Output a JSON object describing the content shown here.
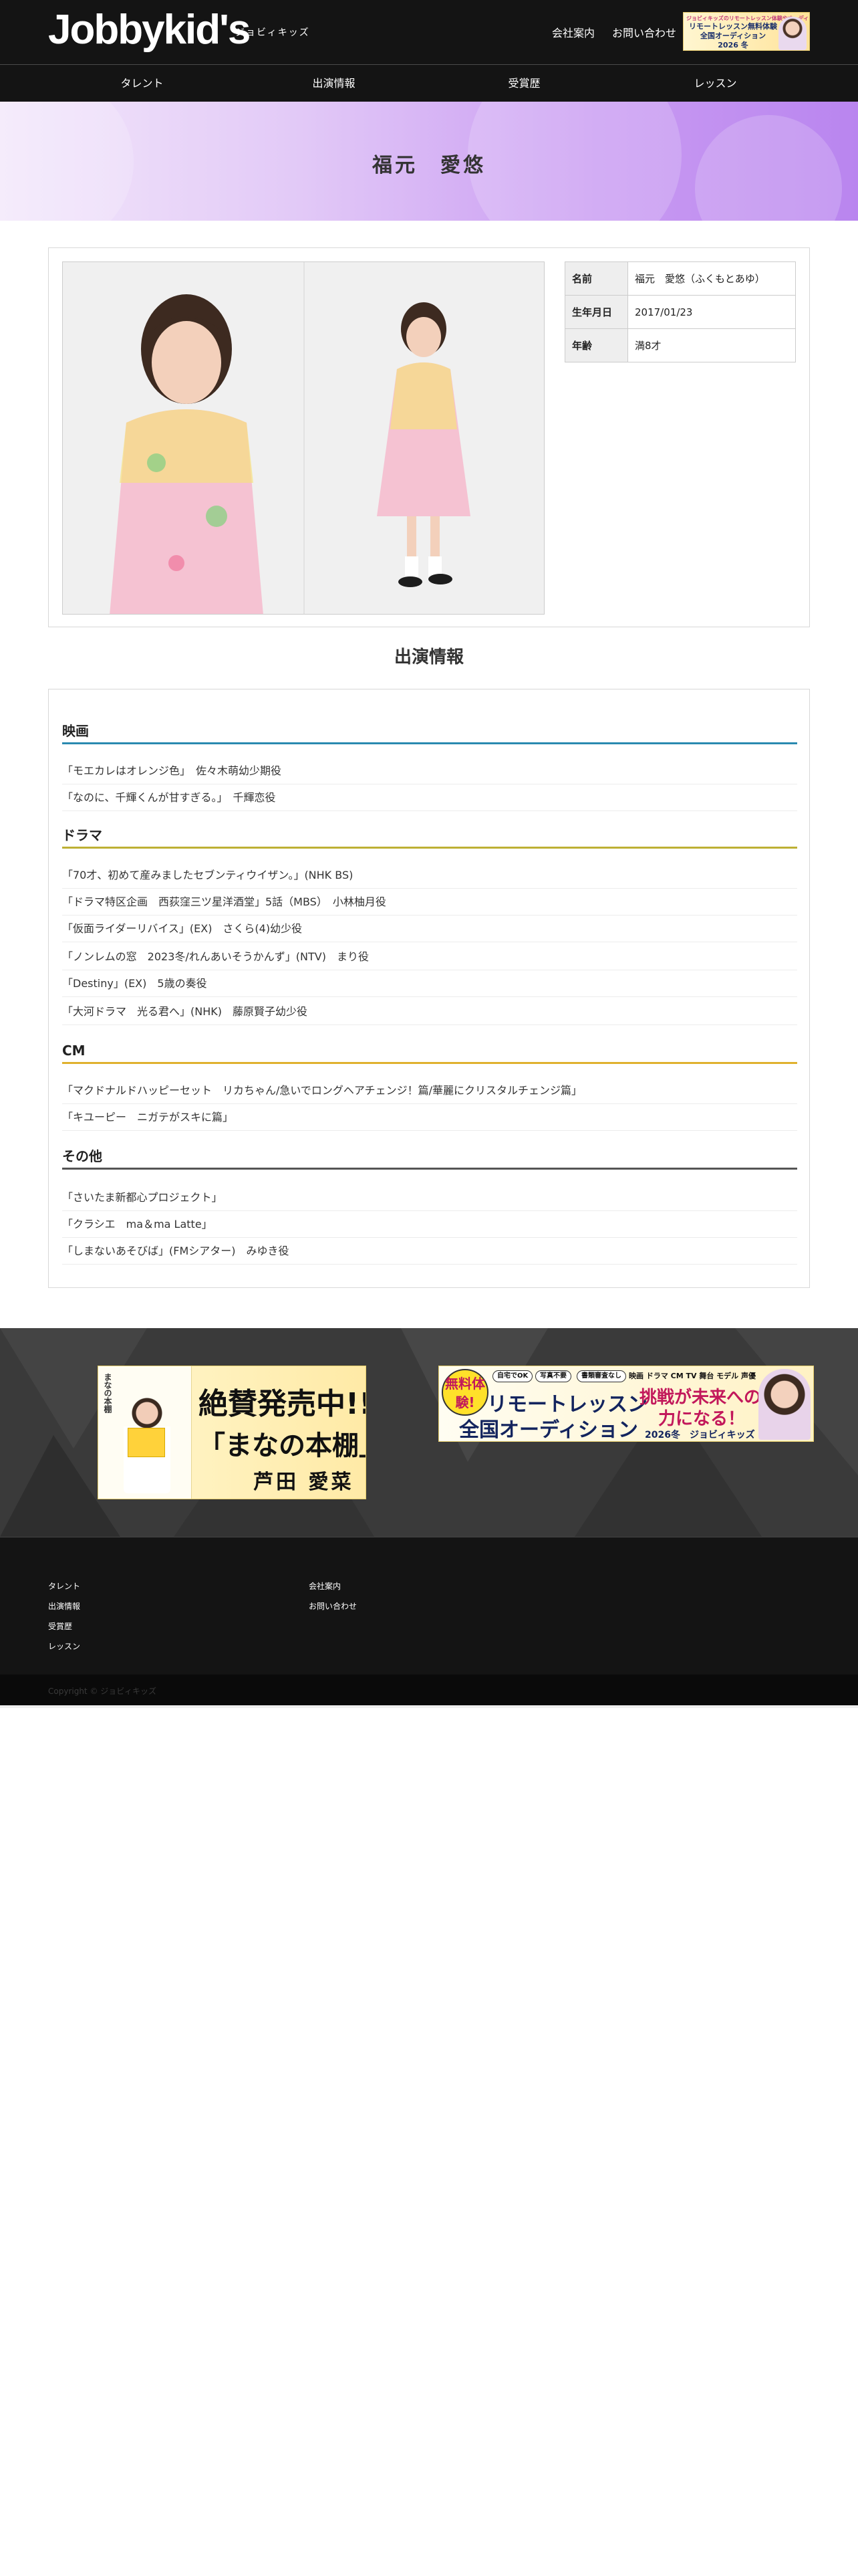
{
  "header": {
    "logo": "Jobbykid's",
    "logo_sub": "ジョビィキッズ",
    "links": [
      "会社案内",
      "お問い合わせ"
    ],
    "banner": {
      "top_text": "ジョビィキッズのリモートレッスン体験やオーディション",
      "main_text": "リモートレッスン無料体験 全国オーディション",
      "year_text": "2026 冬"
    }
  },
  "nav": {
    "items": [
      "タレント",
      "出演情報",
      "受賞歴",
      "レッスン"
    ]
  },
  "hero": {
    "title": "福元　愛悠"
  },
  "profile": {
    "rows": [
      {
        "label": "名前",
        "value": "福元　愛悠（ふくもとあゆ）"
      },
      {
        "label": "生年月日",
        "value": "2017/01/23"
      },
      {
        "label": "年齢",
        "value": "満8才"
      }
    ]
  },
  "appearances": {
    "title": "出演情報",
    "categories": [
      {
        "name": "映画",
        "works": [
          "「モエカレはオレンジ色」　佐々木萌幼少期役",
          "「なのに、千輝くんが甘すぎる。」　千輝恋役"
        ]
      },
      {
        "name": "ドラマ",
        "works": [
          "「70才、初めて産みましたセブンティウイザン。」(NHK BS)",
          "「ドラマ特区企画　西荻窪三ツ星洋酒堂」5話（MBS）　小林柚月役",
          "「仮面ライダーリバイス」(EX)　さくら(4)幼少役",
          "「ノンレムの窓　2023冬/れんあいそうかんず」(NTV)　まり役",
          "「Destiny」(EX)　5歳の奏役",
          "「大河ドラマ　光る君へ」(NHK)　藤原賢子幼少役"
        ]
      },
      {
        "name": "CM",
        "works": [
          "「マクドナルドハッピーセット　リカちゃん/急いでロングヘアチェンジ！篇/華麗にクリスタルチェンジ篇」",
          "「キユーピー　ニガテがスキに篇」"
        ]
      },
      {
        "name": "その他",
        "works": [
          "「さいたま新都心プロジェクト」",
          "「クラシエ　ma＆ma Latte」",
          "「しまないあそびば」(FMシアター)　みゆき役"
        ]
      }
    ]
  },
  "banners": {
    "book": {
      "cover_title": "まなの本棚",
      "line1": "絶賛発売中!!",
      "line2": "「まなの本棚」",
      "line3": "芦田 愛菜"
    },
    "audition": {
      "free": "無料体験!",
      "tags": [
        "自宅でOK",
        "写真不要",
        "書類審査なし"
      ],
      "media": "映画 ドラマ CM TV 舞台 モデル 声優",
      "main1": "リモートレッスン",
      "main2": "全国オーディション",
      "challenge": "挑戦が未来への",
      "power": "力になる！",
      "year": "2026冬　ジョビィキッズ"
    }
  },
  "footer": {
    "col1": [
      "タレント",
      "出演情報",
      "受賞歴",
      "レッスン"
    ],
    "col2": [
      "会社案内",
      "お問い合わせ"
    ],
    "copyright": "Copyright © ジョビィキッズ"
  }
}
